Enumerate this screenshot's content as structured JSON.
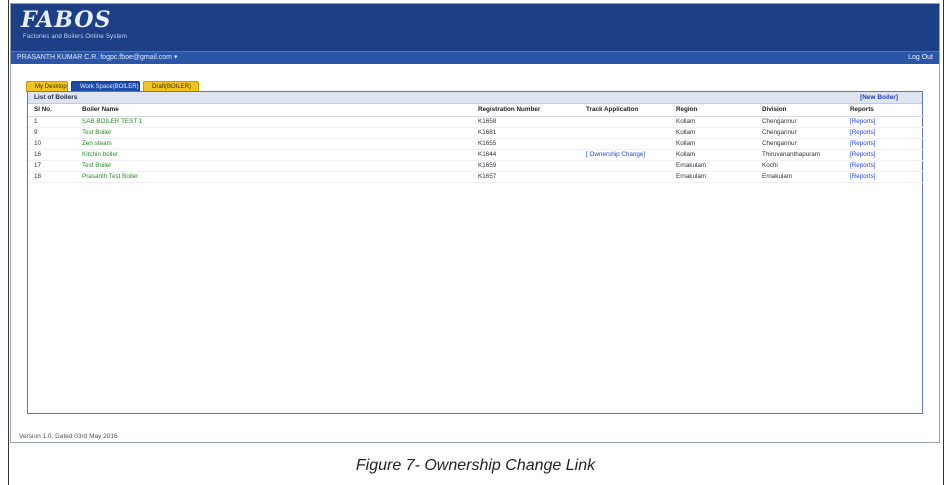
{
  "app": {
    "logo_title": "FABOS",
    "logo_subtitle": "Factories and Boilers Online System"
  },
  "userbar": {
    "user_email": "PRASANTH KUMAR C.R. fogpc.fboe@gmail.com ▾",
    "logout_label": "Log Out"
  },
  "tabs": [
    {
      "label": "My Desktop"
    },
    {
      "label": "Work Space(BOILER)"
    },
    {
      "label": "Draft(BOILER)"
    }
  ],
  "panel": {
    "title": "List of Boilers",
    "new_boiler_label": "[New Boiler]"
  },
  "table": {
    "columns": [
      "Sl No.",
      "Boiler Name",
      "Registration Number",
      "Track Application",
      "Region",
      "Division",
      "Reports"
    ],
    "rows": [
      {
        "sl": "1",
        "name": "SAB BOILER TEST 1",
        "reg": "K1658",
        "track": "",
        "region": "Kollam",
        "division": "Chengannur",
        "reports": "[Reports]"
      },
      {
        "sl": "9",
        "name": "Test Boiler",
        "reg": "K1681",
        "track": "",
        "region": "Kollam",
        "division": "Chengannur",
        "reports": "[Reports]"
      },
      {
        "sl": "10",
        "name": "Zen steam",
        "reg": "K1655",
        "track": "",
        "region": "Kollam",
        "division": "Chengannur",
        "reports": "[Reports]"
      },
      {
        "sl": "16",
        "name": "Kitchin boiler",
        "reg": "K1644",
        "track": "[ Ownership Change]",
        "region": "Kollam",
        "division": "Thiruvananthapuram",
        "reports": "[Reports]"
      },
      {
        "sl": "17",
        "name": "Test Boiler",
        "reg": "K1659",
        "track": "",
        "region": "Ernakulam",
        "division": "Kochi",
        "reports": "[Reports]"
      },
      {
        "sl": "18",
        "name": "Prasanth Test Boiler",
        "reg": "K1657",
        "track": "",
        "region": "Ernakulam",
        "division": "Ernakulam",
        "reports": "[Reports]"
      }
    ]
  },
  "footer": {
    "version": "Version 1.0, Dated 03rd May 2016"
  },
  "caption": "Figure 7- Ownership Change Link"
}
